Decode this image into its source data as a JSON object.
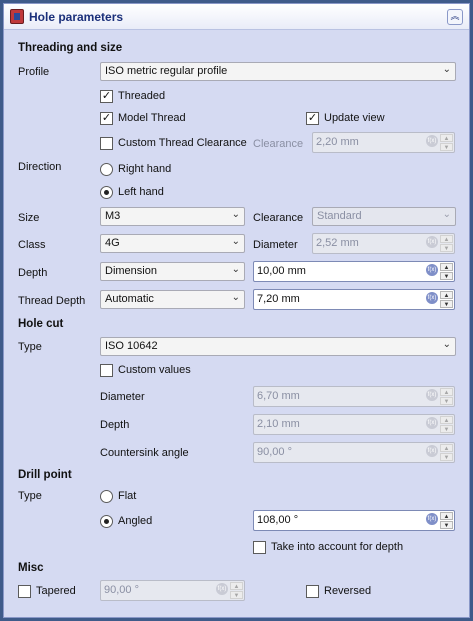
{
  "window": {
    "title": "Hole parameters",
    "collapse_glyph": "︽"
  },
  "threading": {
    "section": "Threading and size",
    "profile_label": "Profile",
    "profile_value": "ISO metric regular profile",
    "threaded_label": "Threaded",
    "threaded_checked": true,
    "model_thread_label": "Model Thread",
    "model_thread_checked": true,
    "update_view_label": "Update view",
    "update_view_checked": true,
    "custom_clearance_label": "Custom Thread Clearance",
    "custom_clearance_checked": false,
    "clearance_label": "Clearance",
    "clearance_value": "2,20 mm",
    "direction_label": "Direction",
    "right_hand_label": "Right hand",
    "left_hand_label": "Left hand",
    "selected_direction": "left",
    "size_label": "Size",
    "size_value": "M3",
    "size_clearance_label": "Clearance",
    "size_clearance_value": "Standard",
    "class_label": "Class",
    "class_value": "4G",
    "diameter_label": "Diameter",
    "diameter_value": "2,52 mm",
    "depth_label": "Depth",
    "depth_mode": "Dimension",
    "depth_value": "10,00 mm",
    "thread_depth_label": "Thread Depth",
    "thread_depth_mode": "Automatic",
    "thread_depth_value": "7,20 mm"
  },
  "holecut": {
    "section": "Hole cut",
    "type_label": "Type",
    "type_value": "ISO 10642",
    "custom_values_label": "Custom values",
    "custom_values_checked": false,
    "diameter_label": "Diameter",
    "diameter_value": "6,70 mm",
    "depth_label": "Depth",
    "depth_value": "2,10 mm",
    "countersink_label": "Countersink angle",
    "countersink_value": "90,00 °"
  },
  "drill": {
    "section": "Drill point",
    "type_label": "Type",
    "flat_label": "Flat",
    "angled_label": "Angled",
    "selected": "angled",
    "angle_value": "108,00 °",
    "take_into_account_label": "Take into account for depth",
    "take_into_account_checked": false
  },
  "misc": {
    "section": "Misc",
    "tapered_label": "Tapered",
    "tapered_checked": false,
    "tapered_value": "90,00 °",
    "reversed_label": "Reversed",
    "reversed_checked": false
  },
  "icons": {
    "spin_fx": "f(x)",
    "combo_arrow": "⌄",
    "check": "✓",
    "spin_up": "▲",
    "spin_down": "▼"
  }
}
